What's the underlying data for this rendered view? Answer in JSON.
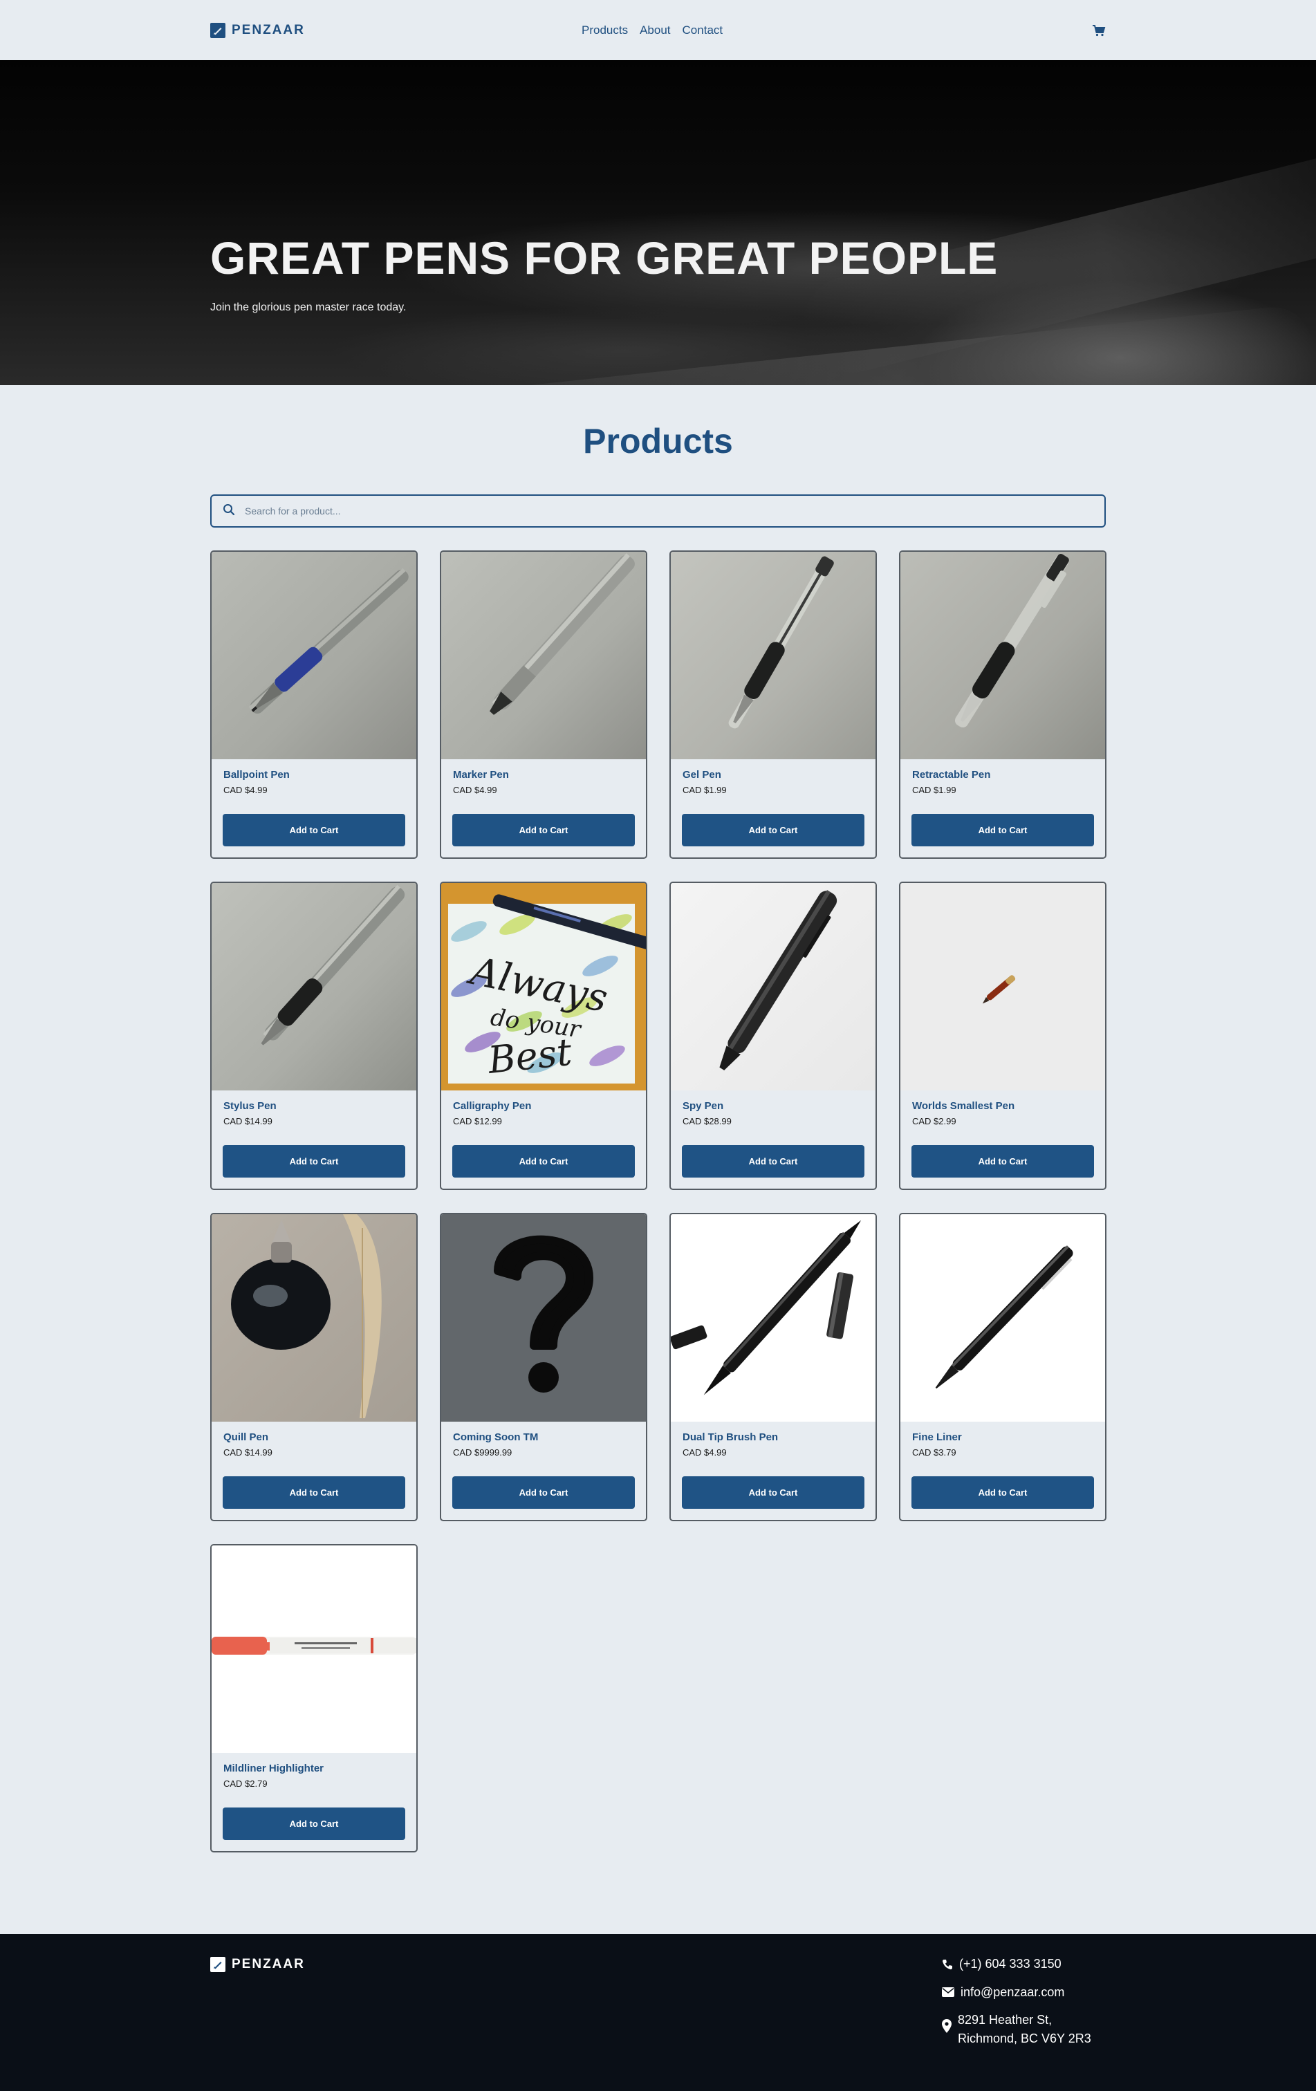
{
  "nav": {
    "brand": "PENZAAR",
    "links": [
      "Products",
      "About",
      "Contact"
    ]
  },
  "hero": {
    "title": "GREAT PENS FOR GREAT PEOPLE",
    "subtitle": "Join the glorious pen master race today."
  },
  "products": {
    "title": "Products",
    "search_placeholder": "Search for a product...",
    "button_label": "Add to Cart",
    "items": [
      {
        "name": "Ballpoint Pen",
        "price": "CAD $4.99"
      },
      {
        "name": "Marker Pen",
        "price": "CAD $4.99"
      },
      {
        "name": "Gel Pen",
        "price": "CAD $1.99"
      },
      {
        "name": "Retractable Pen",
        "price": "CAD $1.99"
      },
      {
        "name": "Stylus Pen",
        "price": "CAD $14.99"
      },
      {
        "name": "Calligraphy Pen",
        "price": "CAD $12.99"
      },
      {
        "name": "Spy Pen",
        "price": "CAD $28.99"
      },
      {
        "name": "Worlds Smallest Pen",
        "price": "CAD $2.99"
      },
      {
        "name": "Quill Pen",
        "price": "CAD $14.99"
      },
      {
        "name": "Coming Soon TM",
        "price": "CAD $9999.99"
      },
      {
        "name": "Dual Tip Brush Pen",
        "price": "CAD $4.99"
      },
      {
        "name": "Fine Liner",
        "price": "CAD $3.79"
      },
      {
        "name": "Mildliner Highlighter",
        "price": "CAD $2.79"
      }
    ],
    "calligraphy_text": [
      "Always",
      "do your",
      "Best"
    ]
  },
  "footer": {
    "brand": "PENZAAR",
    "phone": "(+1) 604 333 3150",
    "email": "info@penzaar.com",
    "address_line1": "8291 Heather St,",
    "address_line2": "Richmond, BC V6Y 2R3"
  },
  "colors": {
    "primary": "#1f4f80",
    "background": "#e7ecf1",
    "footer": "#0a0f17"
  }
}
